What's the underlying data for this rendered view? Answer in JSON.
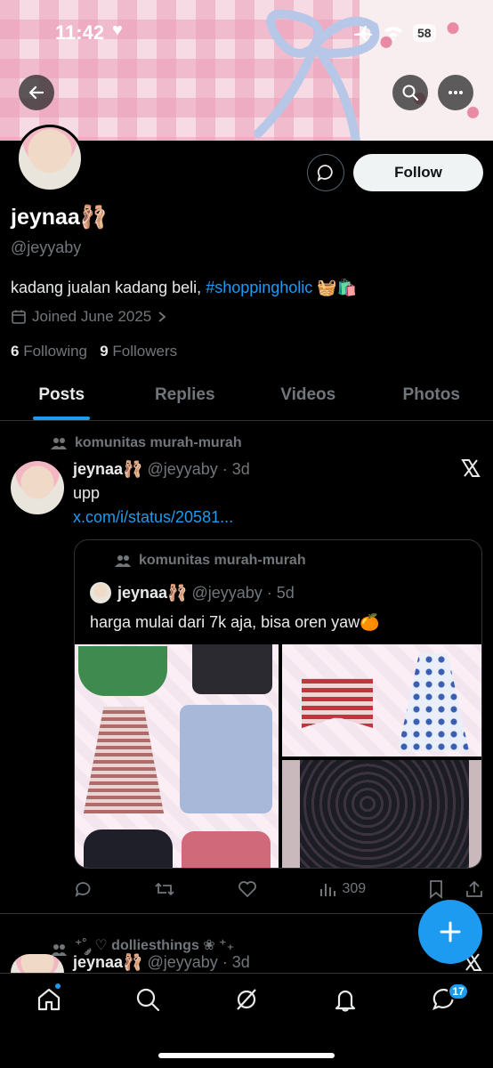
{
  "status_bar": {
    "time": "11:42",
    "battery": "58"
  },
  "profile": {
    "name": "jeynaa",
    "name_emoji": "🩰",
    "handle": "@jeyyaby",
    "bio_text": "kadang jualan kadang beli, ",
    "bio_hashtag": "#shoppingholic",
    "bio_emoji": "🧺🛍️",
    "joined": "Joined June 2025",
    "following_count": "6",
    "following_label": "Following",
    "followers_count": "9",
    "followers_label": "Followers",
    "follow_button": "Follow"
  },
  "tabs": [
    {
      "label": "Posts",
      "active": true
    },
    {
      "label": "Replies",
      "active": false
    },
    {
      "label": "Videos",
      "active": false
    },
    {
      "label": "Photos",
      "active": false
    }
  ],
  "post1": {
    "community": "komunitas murah-murah",
    "author": "jeynaa🩰",
    "handle_time": "@jeyyaby · 3d",
    "text": "upp",
    "link": "x.com/i/status/20581...",
    "views": "309"
  },
  "quote": {
    "community": "komunitas murah-murah",
    "author": "jeynaa🩰",
    "handle_time": "@jeyyaby · 5d",
    "text": "harga mulai dari 7k aja, bisa oren yaw🍊"
  },
  "post2": {
    "community": "⁺˚ ༘ ♡ dolliesthings ❀ ⁺₊",
    "author": "jeynaa🩰",
    "handle_time": "@jeyyaby · 3d"
  },
  "nav": {
    "messages_badge": "17"
  },
  "colors": {
    "accent": "#1d9bf0",
    "background": "#000000",
    "muted": "#71767b"
  }
}
